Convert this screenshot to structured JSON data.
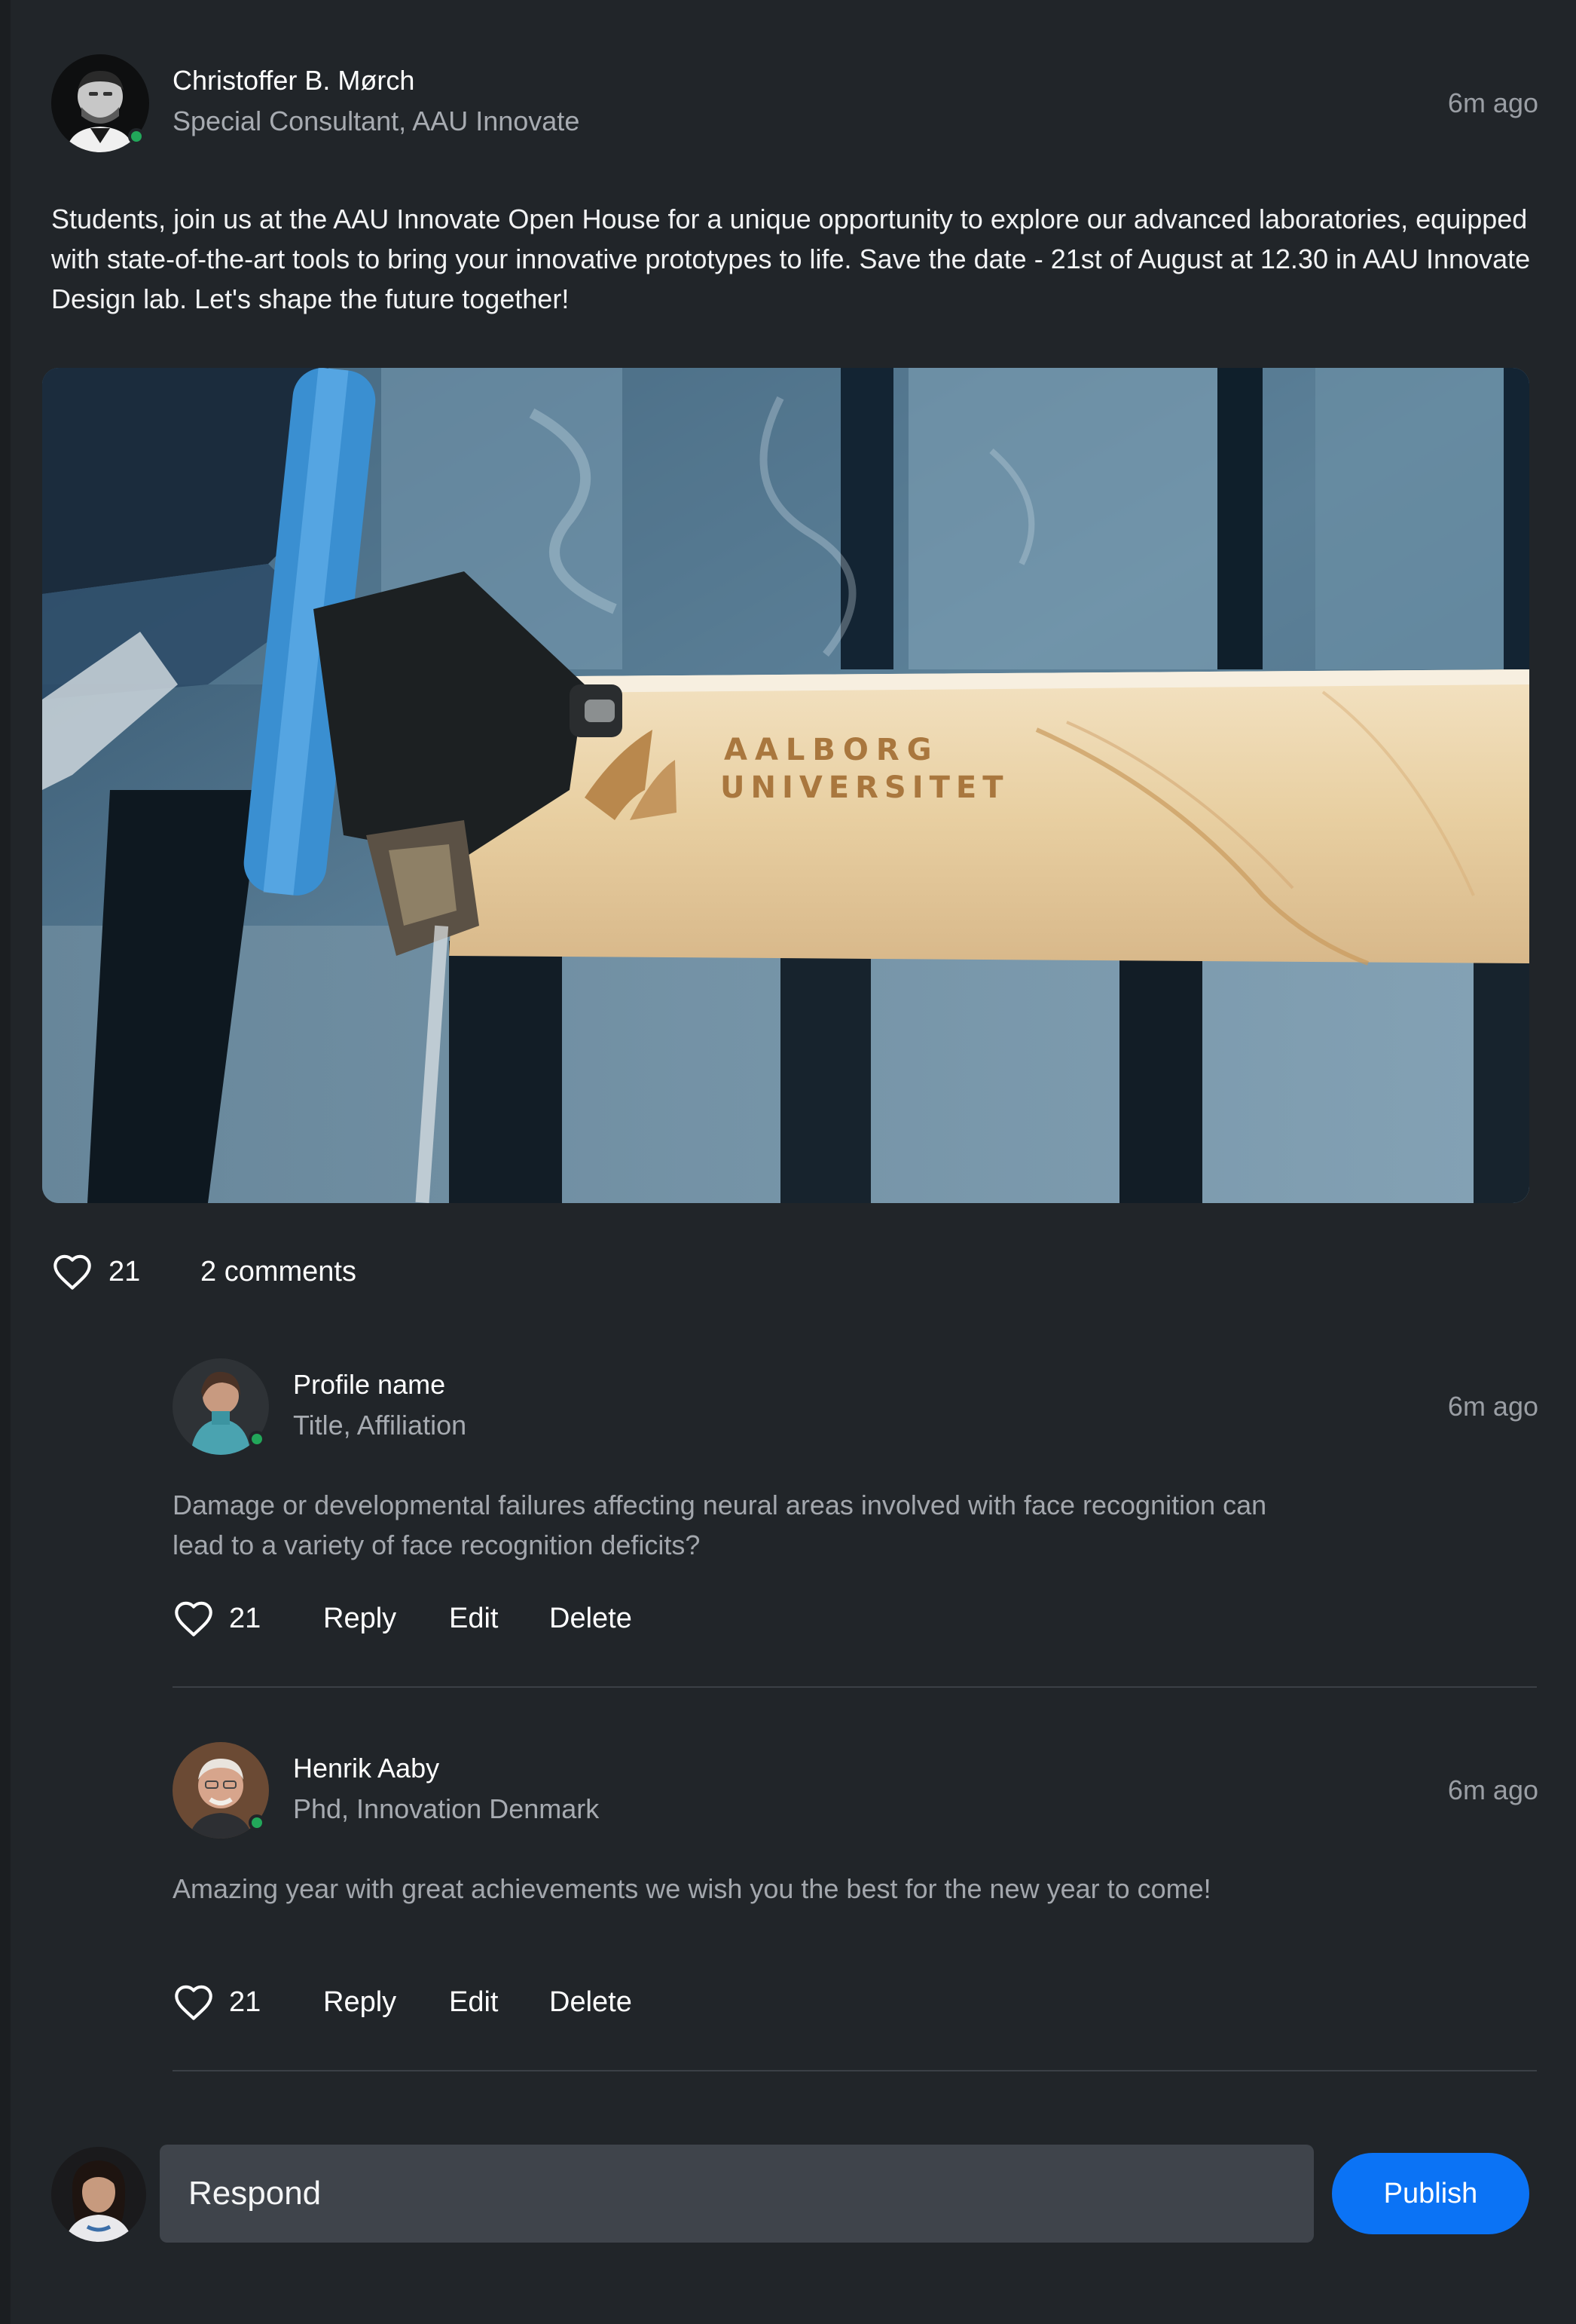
{
  "post": {
    "author_name": "Christoffer B. Mørch",
    "author_title": "Special Consultant, AAU Innovate",
    "timestamp": "6m ago",
    "body": "Students, join us at the AAU Innovate Open House for a unique opportunity to explore our advanced laboratories, equipped with state-of-the-art tools to bring your innovative prototypes to life. Save the date - 21st of August at 12.30 in AAU Innovate Design lab. Let's shape the future together!",
    "image_engraving_line1": "AALBORG",
    "image_engraving_line2": "UNIVERSITET",
    "likes": "21",
    "comments_label": "2 comments"
  },
  "comments": [
    {
      "author_name": "Profile name",
      "author_title": "Title, Affiliation",
      "timestamp": "6m ago",
      "body": "Damage or developmental failures affecting neural areas involved with face recognition can lead to a variety of face recognition deficits?",
      "likes": "21",
      "reply_label": "Reply",
      "edit_label": "Edit",
      "delete_label": "Delete"
    },
    {
      "author_name": "Henrik Aaby",
      "author_title": "Phd, Innovation Denmark",
      "timestamp": "6m ago",
      "body": "Amazing year with great achievements we wish you the best for the new year to come!",
      "likes": "21",
      "reply_label": "Reply",
      "edit_label": "Edit",
      "delete_label": "Delete"
    }
  ],
  "composer": {
    "placeholder": "Respond",
    "publish_label": "Publish"
  },
  "colors": {
    "background": "#212529",
    "accent": "#0b73f5",
    "online": "#22a75a",
    "input_bg": "#3f444b"
  },
  "icons": {
    "like": "heart-outline-icon",
    "online": "online-status-dot"
  }
}
